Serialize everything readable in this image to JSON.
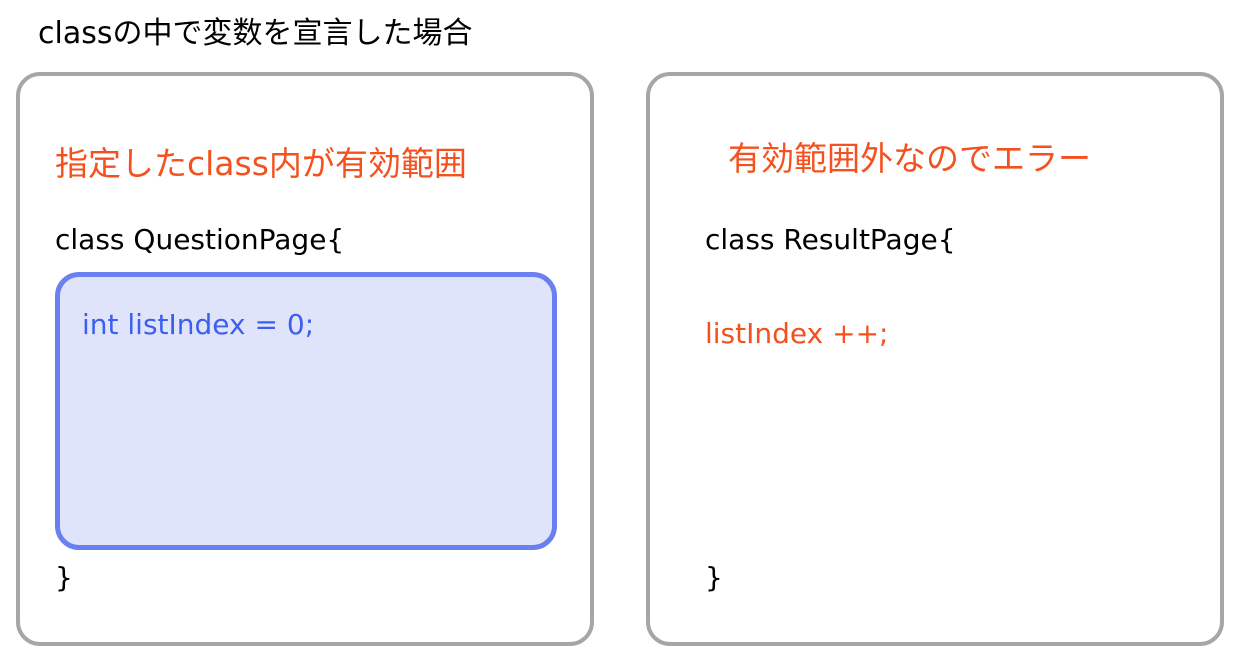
{
  "title": "classの中で変数を宣言した場合",
  "left_panel": {
    "note": "指定したclass内が有効範囲",
    "class_declaration": "class QuestionPage{",
    "variable_declaration": "int listIndex = 0;",
    "closing_brace": "}"
  },
  "right_panel": {
    "note": "有効範囲外なのでエラー",
    "class_declaration": "class ResultPage{",
    "error_statement": "listIndex ++;",
    "closing_brace": "}"
  },
  "colors": {
    "accent_orange": "#f4511e",
    "scope_border": "#6a7ff0",
    "scope_fill": "#e0e4fb",
    "variable_text": "#3d5ff0",
    "panel_border": "#a6a6a6"
  }
}
